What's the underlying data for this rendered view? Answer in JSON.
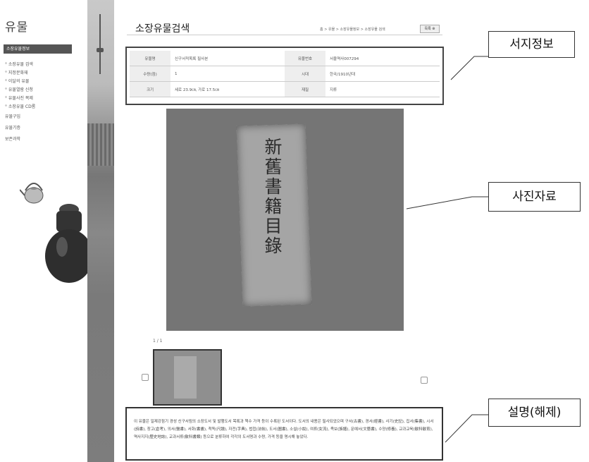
{
  "sidebar": {
    "title": "유물",
    "active_item": "소장유물정보",
    "items": [
      "° 소장유물 검색",
      "° 지정문화재",
      "° 이달의 유물",
      "° 유물열람 신청",
      "° 유물사진 복제",
      "° 소장유물 CD롬",
      "유물구입",
      "유물기증",
      "보존과학"
    ]
  },
  "header": {
    "title": "소장유물검색",
    "breadcrumb": "홈 > 유물 > 소장유물정보 > 소장유물 검색",
    "list_button": "목록 ⊕"
  },
  "info_table": {
    "rows": [
      [
        "유물명",
        "신구서적목록 필사본",
        "유물번호",
        "서울역사007294"
      ],
      [
        "수량(점)",
        "1",
        "시대",
        "한국/1910년대"
      ],
      [
        "크기",
        "세로 23.9㎝, 가로 17.5㎝",
        "재질",
        "지류"
      ]
    ]
  },
  "photo": {
    "cover_text": "新舊書籍目錄",
    "counter": "1 / 1"
  },
  "description": "이 유물은 일제강점기 경성 신구서림의 소장도서 및 발행도서 목록과 책수 가격 등이 수록된 도서이다. 도서의 내용은 필사되었으며 구서(古書), 경서(經書), 사기(史記), 집서(集書), 시서(詩書), 창고(倉考), 의서(醫書), 서화(書畵), 척독(尺牘), 자전(字典), 법첩(法帖), 도서(圖書), 소설(小說), 여류(女流), 족보(族譜), 문예서(文藝書), 수양(修養), 교과교육(敎科敎育), 역사지지(歷史地誌), 교과서류(敎科書類) 등으로 분류하여 각각의 도서명과 수량, 가격 등을 명시해 놓았다.",
  "callouts": {
    "bibliographic": "서지정보",
    "photo": "사진자료",
    "description": "설명(해제)"
  }
}
